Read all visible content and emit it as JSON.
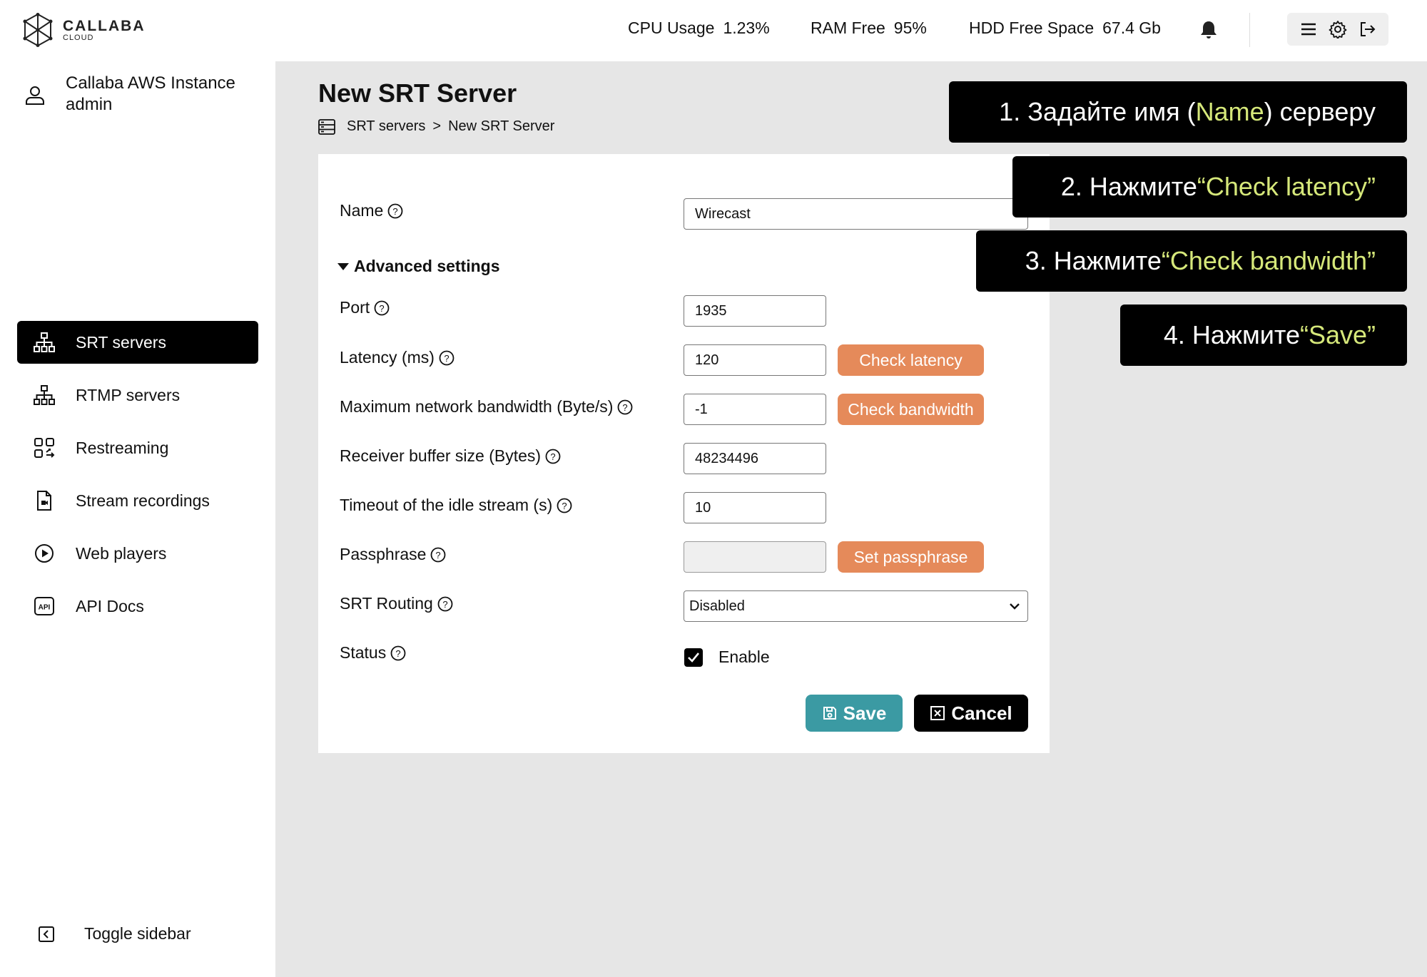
{
  "brand": {
    "name": "CALLABA",
    "sub": "CLOUD"
  },
  "profile": {
    "instance": "Callaba AWS Instance",
    "user": "admin"
  },
  "sidebar": {
    "items": [
      {
        "label": "SRT servers",
        "icon": "sitemap-icon",
        "active": true
      },
      {
        "label": "RTMP servers",
        "icon": "sitemap-icon",
        "active": false
      },
      {
        "label": "Restreaming",
        "icon": "restream-icon",
        "active": false
      },
      {
        "label": "Stream recordings",
        "icon": "video-file-icon",
        "active": false
      },
      {
        "label": "Web players",
        "icon": "play-circle-icon",
        "active": false
      },
      {
        "label": "API Docs",
        "icon": "api-icon",
        "active": false
      }
    ],
    "toggle_label": "Toggle sidebar"
  },
  "topbar": {
    "cpu_label": "CPU Usage",
    "cpu_value": "1.23%",
    "ram_label": "RAM Free",
    "ram_value": "95%",
    "hdd_label": "HDD Free Space",
    "hdd_value": "67.4 Gb"
  },
  "page": {
    "title": "New SRT Server",
    "breadcrumb": [
      "SRT servers",
      ">",
      "New SRT Server"
    ]
  },
  "form": {
    "name_label": "Name",
    "name_value": "Wirecast",
    "advanced_label": "Advanced settings",
    "port_label": "Port",
    "port_value": "1935",
    "latency_label": "Latency (ms)",
    "latency_value": "120",
    "check_latency_label": "Check latency",
    "bandwidth_label": "Maximum network bandwidth (Byte/s)",
    "bandwidth_value": "-1",
    "check_bandwidth_label": "Check bandwidth",
    "buffer_label": "Receiver buffer size (Bytes)",
    "buffer_value": "48234496",
    "timeout_label": "Timeout of the idle stream (s)",
    "timeout_value": "10",
    "passphrase_label": "Passphrase",
    "passphrase_value": "",
    "set_passphrase_label": "Set passphrase",
    "routing_label": "SRT Routing",
    "routing_value": "Disabled",
    "status_label": "Status",
    "status_enable_label": "Enable",
    "status_checked": true,
    "save_label": "Save",
    "cancel_label": "Cancel"
  },
  "callouts": [
    {
      "before": "1. Задайте имя (",
      "highlight": "Name",
      "after": ") серверу"
    },
    {
      "before": "2. Нажмите ",
      "highlight": "“Check latency”",
      "after": ""
    },
    {
      "before": "3. Нажмите ",
      "highlight": "“Check bandwidth”",
      "after": ""
    },
    {
      "before": "4. Нажмите ",
      "highlight": "“Save”",
      "after": ""
    }
  ],
  "colors": {
    "accent_orange": "#e58a5a",
    "save_teal": "#3b9aa3",
    "highlight_yellow": "#d6e87a",
    "active_nav": "#000000"
  }
}
